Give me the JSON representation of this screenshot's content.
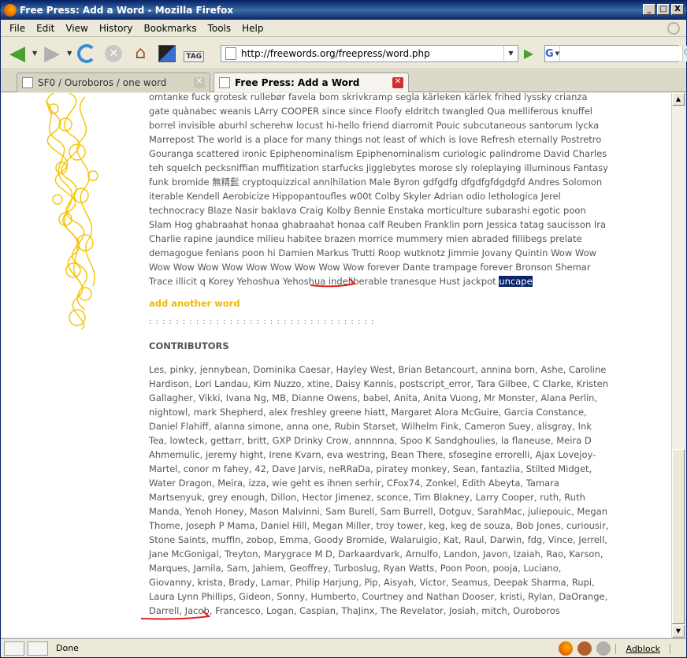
{
  "window": {
    "title": "Free Press: Add a Word - Mozilla Firefox",
    "min_label": "_",
    "max_label": "□",
    "close_label": "X"
  },
  "menu": [
    "File",
    "Edit",
    "View",
    "History",
    "Bookmarks",
    "Tools",
    "Help"
  ],
  "toolbar": {
    "url": "http://freewords.org/freepress/word.php",
    "tag_label": "TAG",
    "search_engine": "G",
    "search_value": ""
  },
  "tabs": [
    {
      "label": "SF0 / Ouroboros / one word",
      "active": false
    },
    {
      "label": "Free Press: Add a Word",
      "active": true
    }
  ],
  "page": {
    "wordlist_text": "omtanke fuck grotesk rullebør favela bom skrivkramp segla kärleken kärlek frihed lyssky crianza gate quànabec weanis LArry COOPER since since Floofy eldritch twangled Qua melliferous knuffel borrel invisible aburhl scherehw locust hi-hello friend diarromit Pouic subcutaneous santorum lycka Marrepost The world is a place for many things not least of which is love Refresh eternally Postretro Gouranga scattered ironic Epiphenominalism Epiphenominalism curiologic palindrome David Charles teh squelch pecksniffian muffitization starfucks jigglebytes morose sly roleplaying illuminous Fantasy funk bromide 無精髭 cryptoquizzical annihilation Male Byron gdfgdfg dfgdfgfdgdgfd Andres Solomon iterable Kendell Aerobicize Hippopantoufles w00t Colby Skyler Adrian odio lethologica Jerel technocracy Blaze Nasir baklava Craig Kolby Bennie Enstaka morticulture subarashi egotic poon Slam Hog ghabraahat honaa ghabraahat honaa calf Reuben Franklin porn Jessica tatag saucisson Ira Charlie rapine jaundice milieu habitee brazen morrice mummery mien abraded fillibegs prelate demagogue fenians poon hi Damien Markus Trutti Roop wutknotz Jimmie Jovany Quintin Wow Wow Wow Wow Wow Wow Wow Wow Wow Wow Wow forever Dante trampage forever Bronson Shemar Trace illicit q Korey Yehoshua Yehoshua indeliberable tranesque Hust jackpot",
    "highlighted_word": "uncape",
    "add_another_word": "add another word",
    "dots": ": : : : : : : : : : : : : : : : : : : : : : : : : : : : : : : : : :",
    "contributors_heading": "CONTRIBUTORS",
    "contributors_text": "Les, pinky, jennybean, Dominika Caesar, Hayley West, Brian Betancourt, annina born, Ashe, Caroline Hardison, Lori Landau, Kim Nuzzo, xtine, Daisy Kannis, postscript_error, Tara Gilbee, C Clarke, Kristen Gallagher, Vikki, Ivana Ng, MB, Dianne Owens, babel, Anita, Anita Vuong, Mr Monster, Alana Perlin, nightowl, mark Shepherd, alex freshley greene hiatt, Margaret Alora McGuire, Garcia Constance, Daniel Flahiff, alanna simone, anna one, Rubin Starset, Wilhelm Fink, Cameron Suey, alisgray, Ink Tea, lowteck, gettarr, britt, GXP Drinky Crow, annnnna, Spoo K Sandghoulies, la flaneuse, Meira D Ahmemulic, jeremy hight, Irene Kvarn, eva westring, Bean There, sfosegine errorelli, Ajax Lovejoy-Martel, conor m fahey, 42, Dave Jarvis, neRRaDa, piratey monkey, Sean, fantazlia, Stilted Midget, Water Dragon, Meira, izza, wie geht es ihnen serhir, CFox74, Zonkel, Edith Abeyta, Tamara Martsenyuk, grey enough, Dillon, Hector Jimenez, sconce, Tim Blakney, Larry Cooper, ruth, Ruth Manda, Yenoh Honey, Mason Malvinni, Sam Burell, Sam Burrell, Dotguv, SarahMac, juliepouic, Megan Thome, Joseph P Mama, Daniel Hill, Megan Miller, troy tower, keg, keg de souza, Bob Jones, curiousir, Stone Saints, muffin, zobop, Emma, Goody Bromide, Walaruigio, Kat, Raul, Darwin, fdg, Vince, Jerrell, Jane McGonigal, Treyton, Marygrace M D, Darkaardvark, Arnulfo, Landon, Javon, Izaiah, Rao, Karson, Marques, Jamila, Sam, Jahiem, Geoffrey, Turboslug, Ryan Watts, Poon Poon, pooja, Luciano, Giovanny, krista, Brady, Lamar, Philip Harjung, Pip, Aisyah, Victor, Seamus, Deepak Sharma, Rupi, Laura Lynn Phillips, Gideon, Sonny, Humberto, Courtney and Nathan Dooser, kristi, Rylan, DaOrange, Darrell, Jacob, Francesco, Logan, Caspian, ThaJinx, The Revelator, Josiah, mitch,",
    "last_contributor": "Ouroboros"
  },
  "status": {
    "text": "Done",
    "adblock": "Adblock"
  },
  "colors": {
    "accent_yellow": "#f0b800",
    "highlight_bg": "#0a246a",
    "red_mark": "#e02020"
  }
}
